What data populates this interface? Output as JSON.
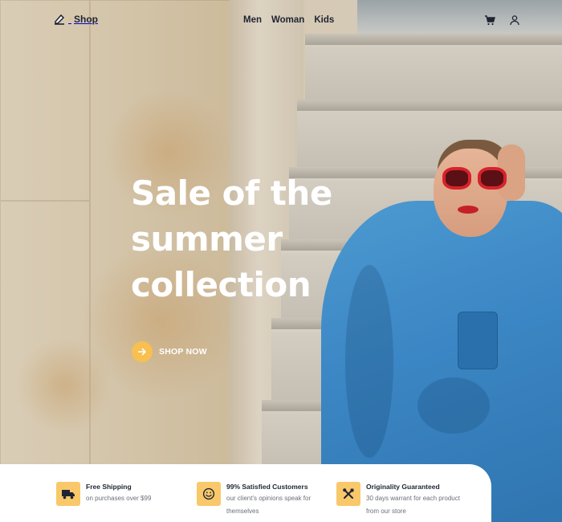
{
  "brand": {
    "name": "Shop",
    "accent_color": "#f8c050"
  },
  "nav": {
    "items": [
      "Men",
      "Woman",
      "Kids"
    ]
  },
  "header_icons": {
    "cart": "cart-icon",
    "user": "user-icon"
  },
  "hero": {
    "title_lines": [
      "Sale of the",
      "summer",
      "collection"
    ],
    "cta_label": "SHOP NOW",
    "cta_icon": "arrow-right-icon"
  },
  "features": [
    {
      "icon": "truck-icon",
      "title": "Free Shipping",
      "desc_lines": [
        "on purchases over $99"
      ]
    },
    {
      "icon": "smile-icon",
      "title": "99% Satisfied Customers",
      "desc_lines": [
        "our client's opinions speak for",
        "themselves"
      ]
    },
    {
      "icon": "tools-icon",
      "title": "Originality Guaranteed",
      "desc_lines": [
        "30 days warrant for each product",
        "from our store"
      ]
    }
  ]
}
